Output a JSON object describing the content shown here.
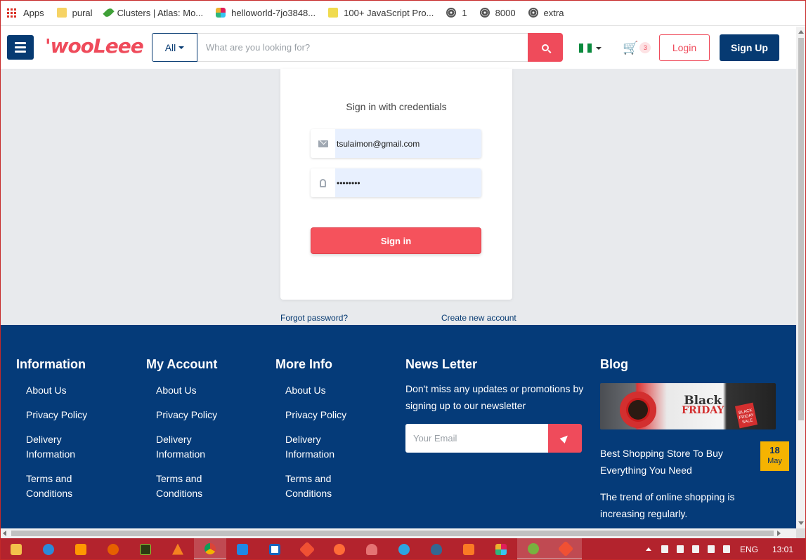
{
  "bookmarks": [
    {
      "label": "Apps",
      "icon": "apps-grid-icon"
    },
    {
      "label": "pural",
      "icon": "folder-icon"
    },
    {
      "label": "Clusters | Atlas: Mo...",
      "icon": "mongodb-leaf-icon"
    },
    {
      "label": "helloworld-7jo3848...",
      "icon": "slack-icon"
    },
    {
      "label": "100+ JavaScript Pro...",
      "icon": "js-icon"
    },
    {
      "label": "1",
      "icon": "globe-icon"
    },
    {
      "label": "8000",
      "icon": "globe-icon"
    },
    {
      "label": "extra",
      "icon": "globe-icon"
    }
  ],
  "header": {
    "logo_part1": "'woo",
    "logo_part2": "Leee",
    "category_label": "All",
    "search_placeholder": "What are you looking for?",
    "cart_count": "3",
    "login_label": "Login",
    "signup_label": "Sign Up"
  },
  "signin": {
    "title": "Sign in with credentials",
    "email_value": "tsulaimon@gmail.com",
    "password_value": "••••••••",
    "submit_label": "Sign in",
    "forgot_label": "Forgot password?",
    "create_label": "Create new account"
  },
  "footer": {
    "columns": [
      {
        "title": "Information",
        "links": [
          "About Us",
          "Privacy Policy",
          "Delivery Information",
          "Terms and Conditions"
        ]
      },
      {
        "title": "My Account",
        "links": [
          "About Us",
          "Privacy Policy",
          "Delivery Information",
          "Terms and Conditions"
        ]
      },
      {
        "title": "More Info",
        "links": [
          "About Us",
          "Privacy Policy",
          "Delivery Information",
          "Terms and Conditions"
        ]
      }
    ],
    "newsletter": {
      "title": "News Letter",
      "text": "Don't miss any updates or promotions by signing up to our newsletter",
      "placeholder": "Your Email"
    },
    "blog": {
      "title": "Blog",
      "post_title": "Best Shopping Store To Buy Everything You Need",
      "excerpt": "The trend of online shopping is increasing regularly.",
      "date_day": "18",
      "date_month": "May",
      "image_text_1": "Black",
      "image_text_2": "FRIDAY",
      "image_tag": "BLACK FRIDAY SALE"
    }
  },
  "taskbar": {
    "language": "ENG",
    "time": "13:01"
  },
  "colors": {
    "navy": "#063a72",
    "footer_bg": "#053b79",
    "accent_red": "#ef4b5b",
    "page_bg": "#e8eaed",
    "taskbar_bg": "#b3232d",
    "badge_yellow": "#f5b301"
  }
}
